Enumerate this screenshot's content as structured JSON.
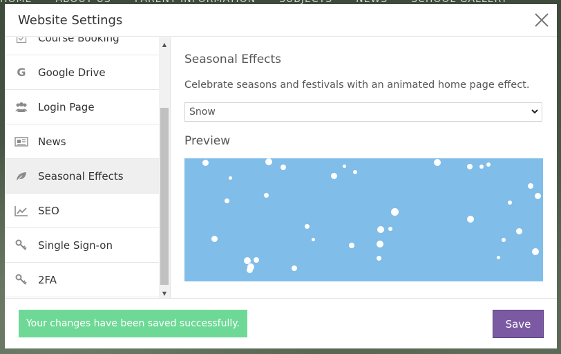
{
  "background_nav": [
    "HOME",
    "ABOUT US",
    "PARENT INFORMATION",
    "SUBJECTS",
    "NEWS",
    "SCHOOL GALLERY"
  ],
  "modal": {
    "title": "Website Settings",
    "close_icon": "close-icon"
  },
  "sidebar": {
    "items": [
      {
        "label": "Course Booking",
        "icon": "checkbox-icon"
      },
      {
        "label": "Google Drive",
        "icon": "google-icon"
      },
      {
        "label": "Login Page",
        "icon": "users-icon"
      },
      {
        "label": "News",
        "icon": "newspaper-icon"
      },
      {
        "label": "Seasonal Effects",
        "icon": "leaf-icon",
        "active": true
      },
      {
        "label": "SEO",
        "icon": "chart-line-icon"
      },
      {
        "label": "Single Sign-on",
        "icon": "key-icon"
      },
      {
        "label": "2FA",
        "icon": "key-icon"
      }
    ]
  },
  "content": {
    "title": "Seasonal Effects",
    "description": "Celebrate seasons and festivals with an animated home page effect.",
    "effect_select": {
      "value": "Snow"
    },
    "preview_label": "Preview"
  },
  "footer": {
    "message": "Your changes have been saved successfully.",
    "save_label": "Save"
  },
  "colors": {
    "preview_sky": "#80bde9",
    "toast_green": "#6ed996",
    "save_purple": "#7c5aa3"
  }
}
